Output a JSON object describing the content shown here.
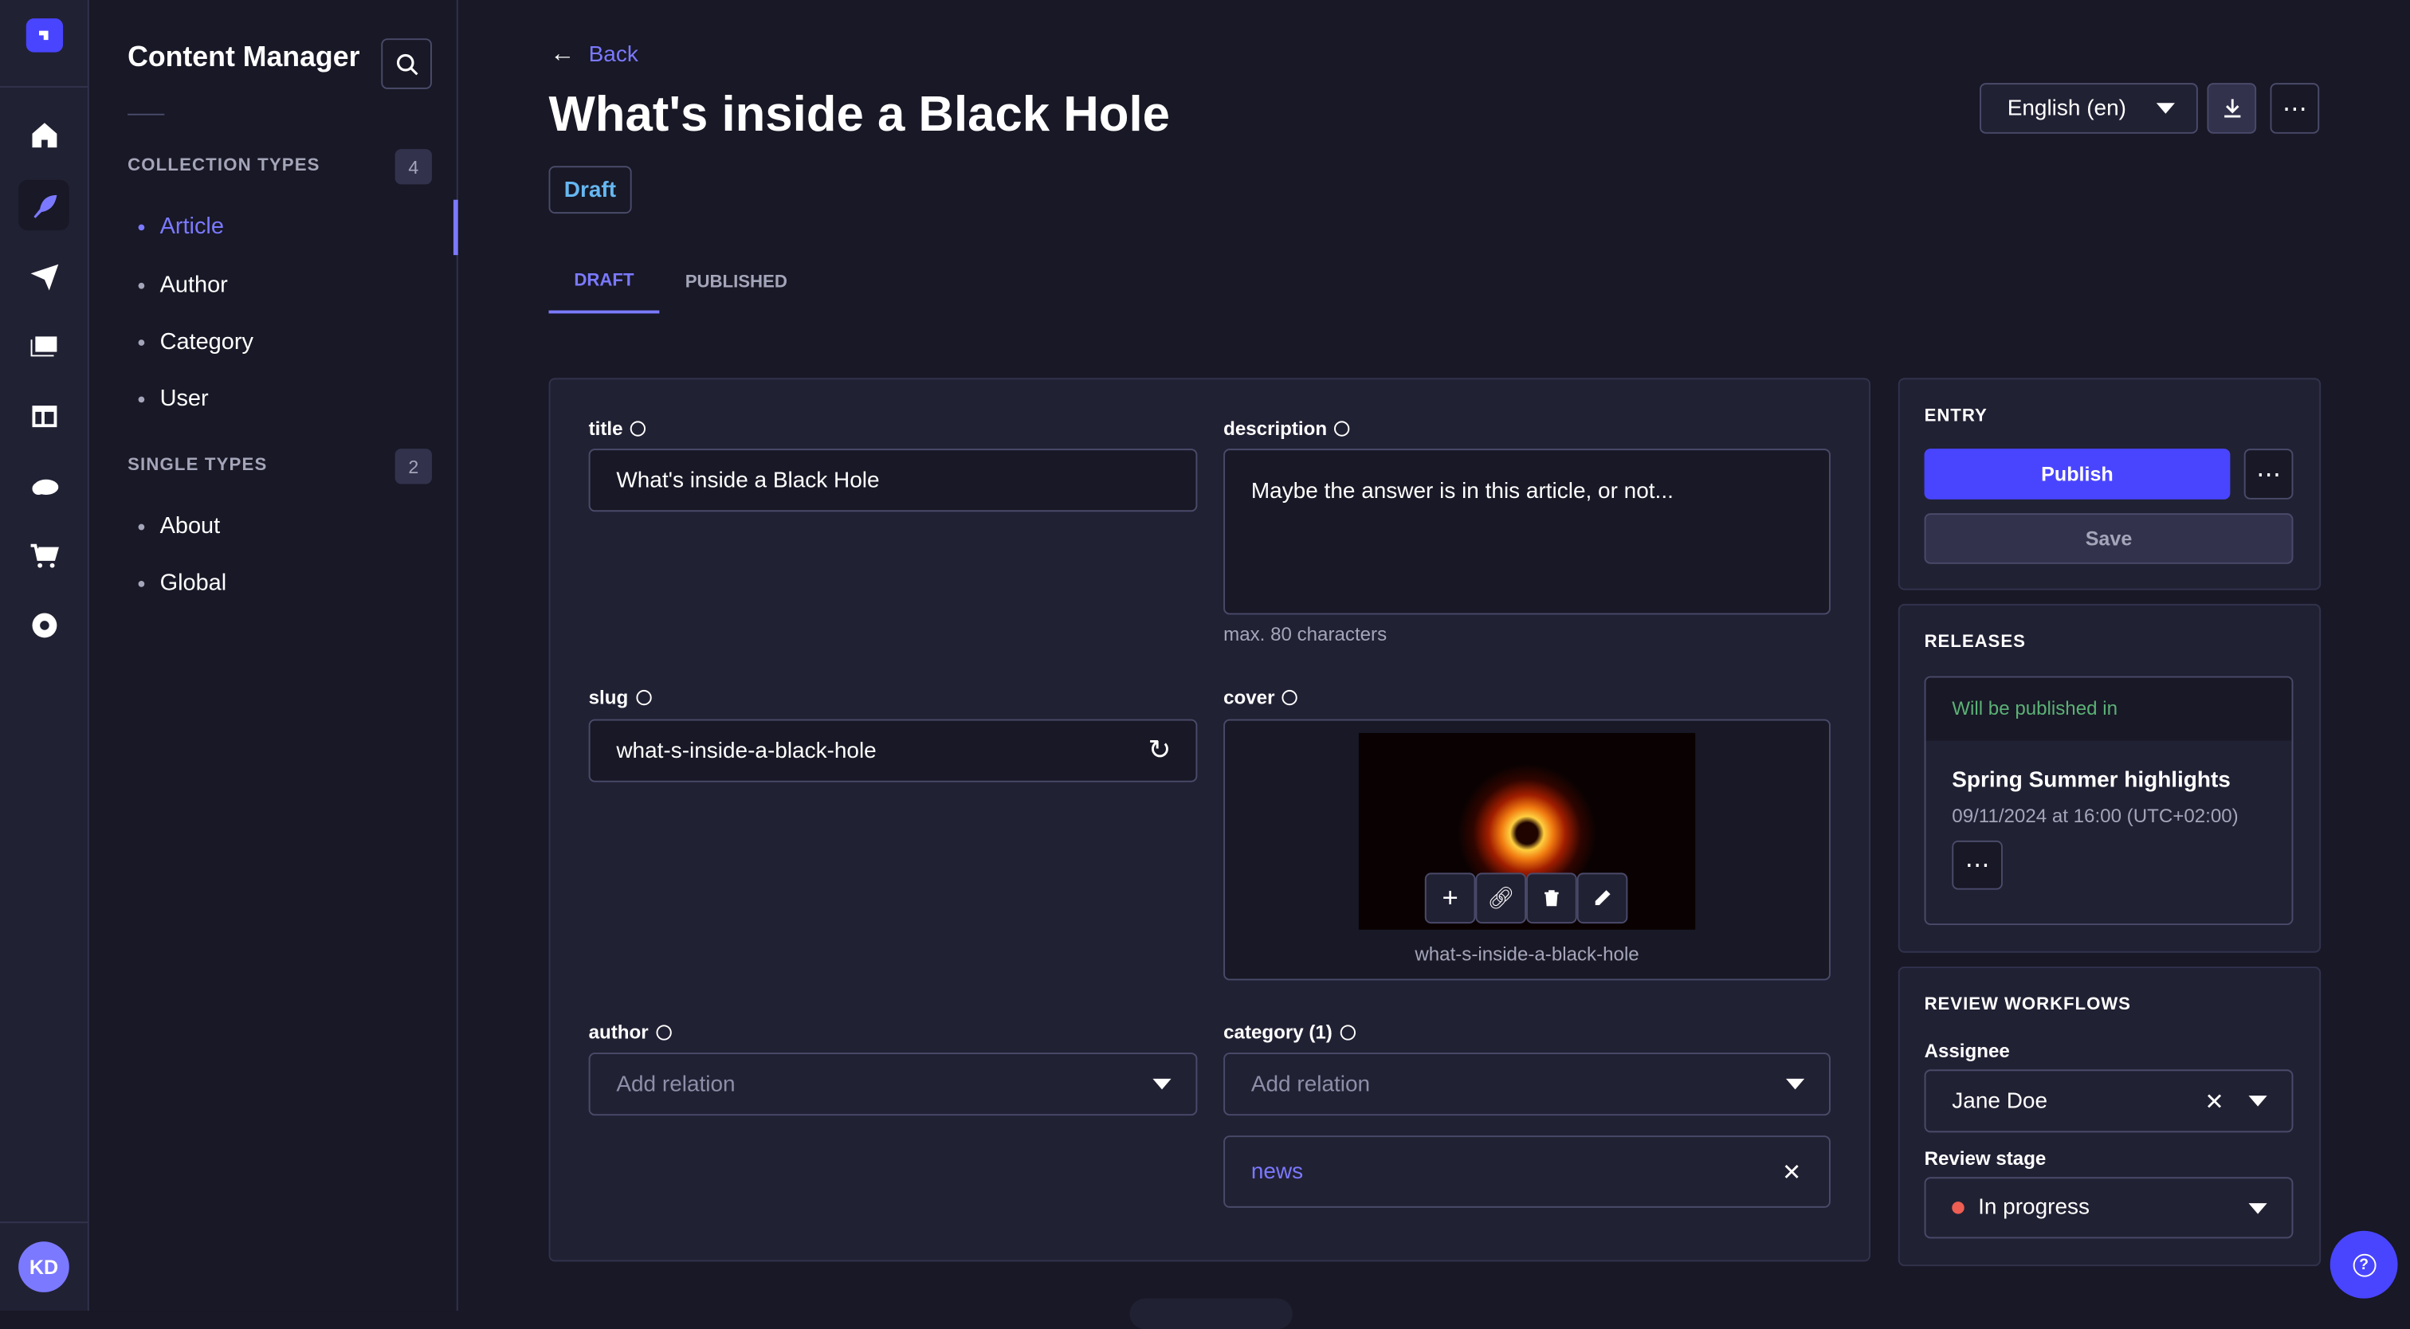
{
  "app": {
    "title": "Content Manager",
    "user_initials": "KD"
  },
  "nav": {
    "icons": [
      "logo-icon",
      "home-icon",
      "content-manager-icon",
      "deploy-icon",
      "media-library-icon",
      "content-type-builder-icon",
      "cloud-icon",
      "marketplace-icon",
      "settings-icon"
    ]
  },
  "sidebar": {
    "collection_types": {
      "label": "COLLECTION TYPES",
      "count": "4",
      "items": [
        {
          "label": "Article",
          "active": true
        },
        {
          "label": "Author"
        },
        {
          "label": "Category"
        },
        {
          "label": "User"
        }
      ]
    },
    "single_types": {
      "label": "SINGLE TYPES",
      "count": "2",
      "items": [
        {
          "label": "About"
        },
        {
          "label": "Global"
        }
      ]
    }
  },
  "header": {
    "back": "Back",
    "title": "What's inside a Black Hole",
    "status_badge": "Draft",
    "locale": "English (en)"
  },
  "tabs": [
    {
      "label": "DRAFT",
      "active": true
    },
    {
      "label": "PUBLISHED"
    }
  ],
  "form": {
    "title": {
      "label": "title",
      "value": "What's inside a Black Hole"
    },
    "description": {
      "label": "description",
      "value": "Maybe the answer is in this article, or not...",
      "hint": "max. 80 characters"
    },
    "slug": {
      "label": "slug",
      "value": "what-s-inside-a-black-hole"
    },
    "cover": {
      "label": "cover",
      "filename": "what-s-inside-a-black-hole"
    },
    "author": {
      "label": "author",
      "placeholder": "Add relation"
    },
    "category": {
      "label": "category (1)",
      "placeholder": "Add relation",
      "relations": [
        "news"
      ]
    }
  },
  "entry": {
    "title": "ENTRY",
    "publish": "Publish",
    "save": "Save"
  },
  "releases": {
    "title": "RELEASES",
    "status": "Will be published in",
    "name": "Spring Summer highlights",
    "date": "09/11/2024 at 16:00 (UTC+02:00)"
  },
  "review": {
    "title": "REVIEW WORKFLOWS",
    "assignee_label": "Assignee",
    "assignee": "Jane Doe",
    "stage_label": "Review stage",
    "stage": "In progress",
    "stage_color": "#ee5e52"
  },
  "colors": {
    "primary": "#4945ff",
    "link": "#7b79ff",
    "success": "#5cb176"
  }
}
